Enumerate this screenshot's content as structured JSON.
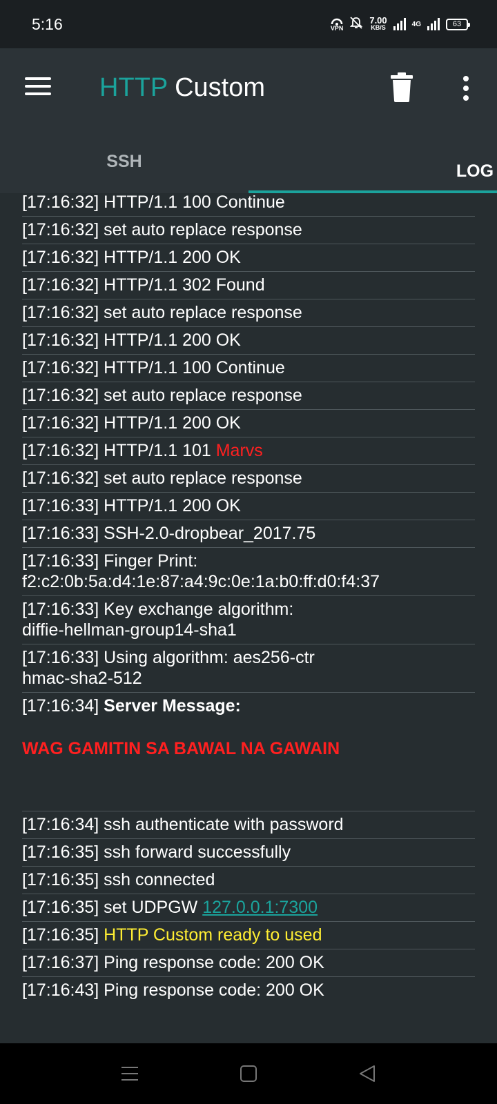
{
  "status": {
    "time": "5:16",
    "vpn": "VPN",
    "speed_value": "7.00",
    "speed_unit": "KB/S",
    "network": "4G",
    "battery": "63"
  },
  "appbar": {
    "title_accent": "HTTP",
    "title_rest": " Custom",
    "icons": [
      "menu-icon",
      "trash-icon",
      "more-vert-icon"
    ]
  },
  "tabs": [
    {
      "label": "SSH",
      "selected": false
    },
    {
      "label": "LOG",
      "selected": true
    }
  ],
  "colors": {
    "accent": "#1ba39c",
    "error_text": "#ff2020",
    "ready_text": "#ffee33",
    "background": "#262d30"
  },
  "log": {
    "first_partial": "[17:16:32] HTTP/1.1 100 Continue",
    "e1": "[17:16:32] set auto replace response",
    "e2": "[17:16:32] HTTP/1.1 200 OK",
    "e3": "[17:16:32] HTTP/1.1 302 Found",
    "e4": "[17:16:32] set auto replace response",
    "e5": "[17:16:32] HTTP/1.1 200 OK",
    "e6": "[17:16:32] HTTP/1.1 100 Continue",
    "e7": "[17:16:32] set auto replace response",
    "e8": "[17:16:32] HTTP/1.1 200 OK",
    "e9_prefix": "[17:16:32] HTTP/1.1 101 ",
    "e9_red": "Marvs",
    "e10": "[17:16:32] set auto replace response",
    "e11": "[17:16:33] HTTP/1.1 200 OK",
    "e12": "[17:16:33] SSH-2.0-dropbear_2017.75",
    "e13_line1": "[17:16:33] Finger Print:",
    "e13_line2": "f2:c2:0b:5a:d4:1e:87:a4:9c:0e:1a:b0:ff:d0:f4:37",
    "e14_line1": "[17:16:33] Key exchange algorithm:",
    "e14_line2": "diffie-hellman-group14-sha1",
    "e15_line1": "[17:16:33] Using algorithm: aes256-ctr",
    "e15_line2": "hmac-sha2-512",
    "e16_prefix": "[17:16:34] ",
    "e16_bold": "Server Message:",
    "e16_message": "WAG GAMITIN SA BAWAL NA GAWAIN",
    "e17": "[17:16:34] ssh authenticate with password",
    "e18": "[17:16:35] ssh forward successfully",
    "e19": "[17:16:35] ssh connected",
    "e20_prefix": "[17:16:35] set UDPGW ",
    "e20_link": "127.0.0.1:7300",
    "e21_prefix": "[17:16:35] ",
    "e21_yellow": "HTTP Custom ready to used",
    "e22": "[17:16:37] Ping response code: 200 OK",
    "e23": "[17:16:43] Ping response code: 200 OK"
  },
  "navbar": {
    "icons": [
      "recents-icon",
      "home-icon",
      "back-icon"
    ]
  }
}
